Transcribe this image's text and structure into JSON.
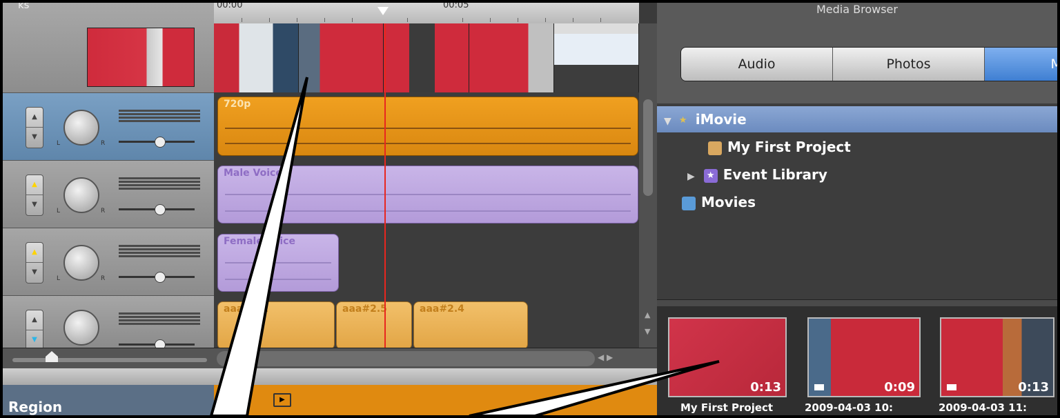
{
  "timeline": {
    "title": "ks",
    "ruler": {
      "label_start": "00:00",
      "label_mid": "00:05"
    },
    "tracks": [
      {
        "label": "720p"
      },
      {
        "label": "Male Voice"
      },
      {
        "label": "Female Voice"
      },
      {
        "labels": [
          "aaa#2.1",
          "aaa#2.5",
          "aaa#2.4"
        ]
      }
    ]
  },
  "region": {
    "label": "Region"
  },
  "media_browser": {
    "title": "Media Browser",
    "tabs": [
      "Audio",
      "Photos",
      "Mo"
    ],
    "active_tab": 2,
    "tree": [
      {
        "label": "iMovie",
        "icon": "star-icon"
      },
      {
        "label": "My First Project",
        "icon": "project-icon"
      },
      {
        "label": "Event Library",
        "icon": "event-star-icon"
      },
      {
        "label": "Movies",
        "icon": "movies-icon"
      }
    ],
    "items": [
      {
        "duration": "0:13",
        "caption": "My First Project"
      },
      {
        "duration": "0:09",
        "caption": "2009-04-03 10:"
      },
      {
        "duration": "0:13",
        "caption": "2009-04-03 11:"
      }
    ]
  },
  "colors": {
    "accent": "#3f7fd2",
    "playhead": "#e8261f",
    "audio_clip": "#e08a10",
    "voice_clip": "#b39bd9"
  }
}
